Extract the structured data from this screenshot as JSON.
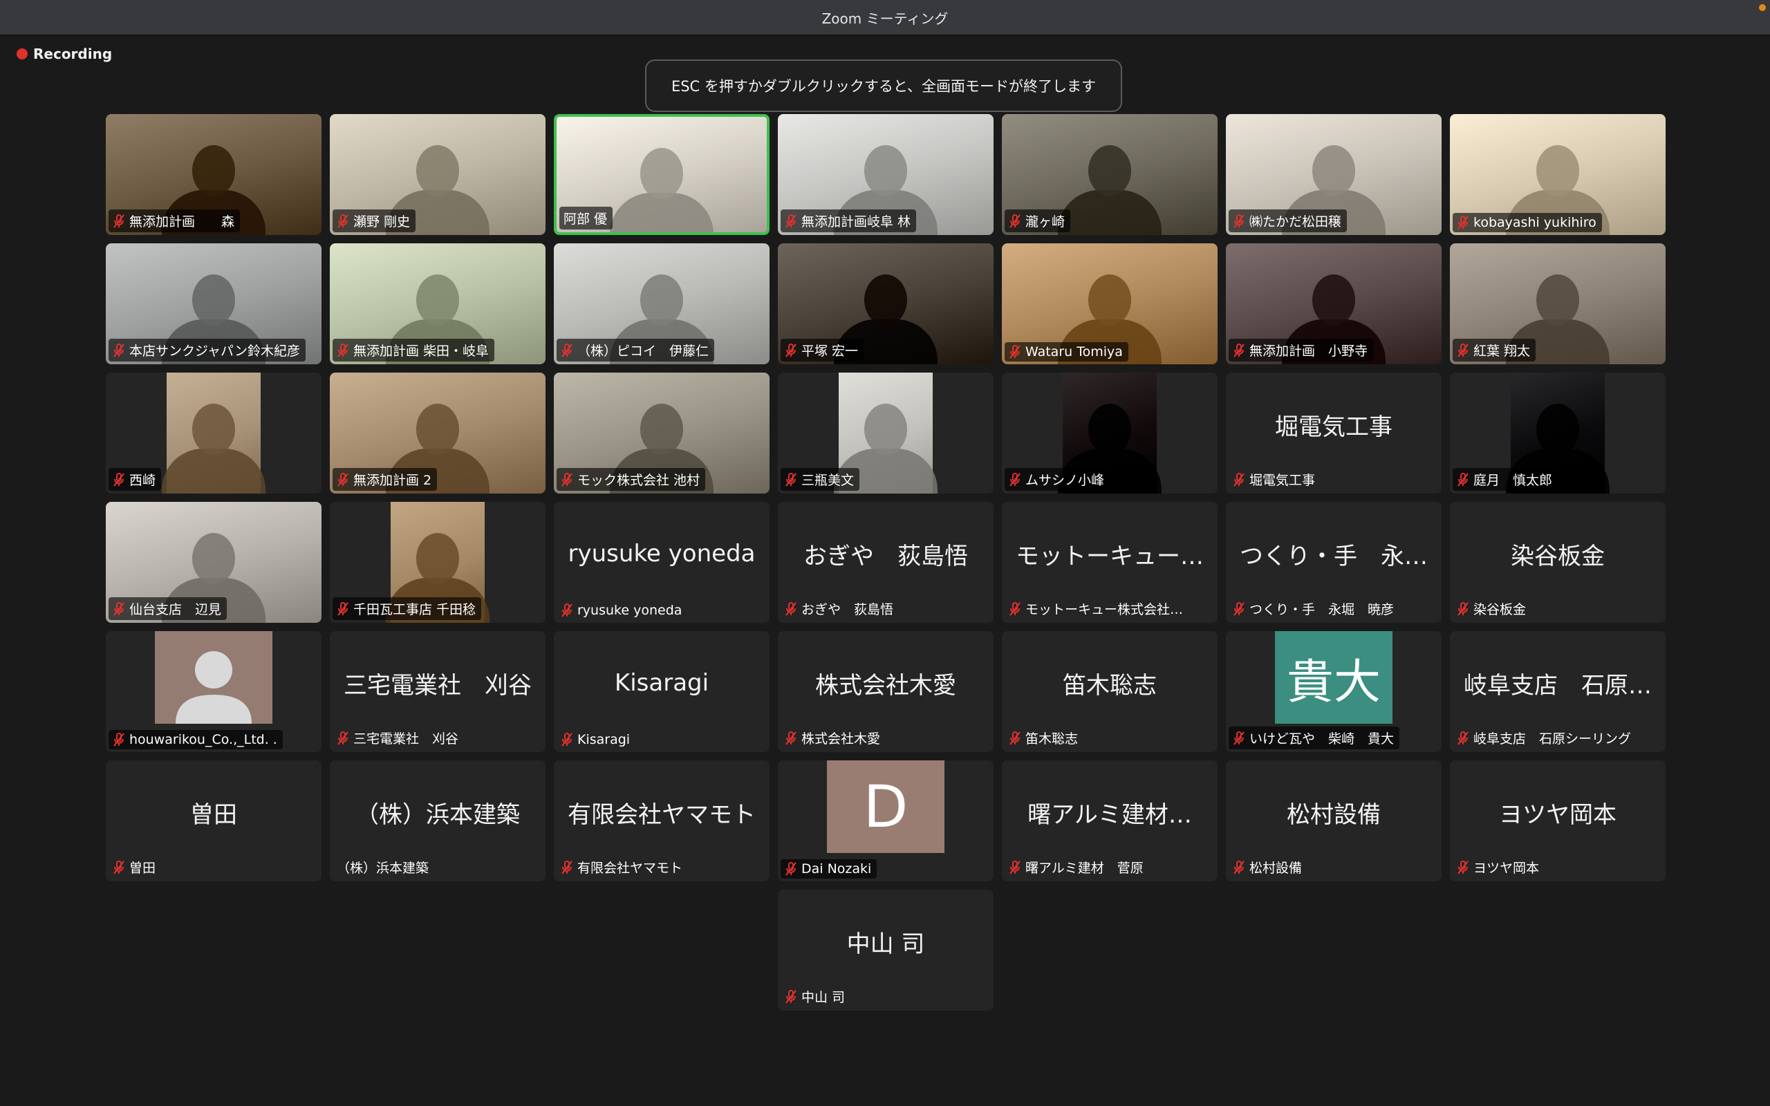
{
  "window": {
    "title": "Zoom ミーティング"
  },
  "recording": {
    "label": "Recording"
  },
  "banner": {
    "text": "ESC を押すかダブルクリックすると、全画面モードが終了します"
  },
  "participants": [
    {
      "name": "無添加計画　　森",
      "video": true,
      "bg": "#6d5a42",
      "muted": true
    },
    {
      "name": "瀬野 剛史",
      "video": true,
      "bg": "#bfb7a5",
      "muted": true
    },
    {
      "name": "阿部 優",
      "video": true,
      "bg": "#d6d1c7",
      "muted": false,
      "active": true
    },
    {
      "name": "無添加計画岐阜 林",
      "video": true,
      "bg": "#c5c5c2",
      "muted": true
    },
    {
      "name": "瀧ヶ崎",
      "video": true,
      "bg": "#6f6a5e",
      "muted": true
    },
    {
      "name": "㈱たかだ松田穣",
      "video": true,
      "bg": "#c9c3b8",
      "muted": true
    },
    {
      "name": "kobayashi yukihiro",
      "video": true,
      "bg": "#d8cbb2",
      "muted": true
    },
    {
      "name": "本店サンクジャパン鈴木紀彦",
      "video": true,
      "bg": "#9fa0a0",
      "muted": true
    },
    {
      "name": "無添加計画 柴田・岐阜",
      "video": true,
      "bg": "#b9c2a6",
      "muted": true
    },
    {
      "name": "（株）ピコイ　伊藤仁",
      "video": true,
      "bg": "#b9b9b5",
      "muted": true
    },
    {
      "name": "平塚 宏一",
      "video": true,
      "bg": "#4a4138",
      "muted": true
    },
    {
      "name": "Wataru Tomiya",
      "video": true,
      "bg": "#b08a5c",
      "muted": true
    },
    {
      "name": "無添加計画　小野寺",
      "video": true,
      "bg": "#5a4a4a",
      "muted": true
    },
    {
      "name": "紅葉 翔太",
      "video": true,
      "bg": "#8f8478",
      "muted": true
    },
    {
      "name": "西崎",
      "video": true,
      "bg": "#a89277",
      "muted": true,
      "pillar": true
    },
    {
      "name": "無添加計画 2",
      "video": true,
      "bg": "#a58c6f",
      "muted": true
    },
    {
      "name": "モック株式会社 池村",
      "video": true,
      "bg": "#9a9487",
      "muted": true
    },
    {
      "name": "三瓶美文",
      "video": true,
      "bg": "#c2c1bb",
      "muted": true,
      "pillar": true
    },
    {
      "name": "ムサシノ小峰",
      "video": true,
      "bg": "#120a0a",
      "muted": true,
      "pillar": true
    },
    {
      "name": "堀電気工事",
      "center": "堀電気工事",
      "muted": true
    },
    {
      "name": "庭月　慎太郎",
      "video": true,
      "bg": "#0a0a0d",
      "muted": true,
      "pillar": true
    },
    {
      "name": "仙台支店　辺見",
      "video": true,
      "bg": "#b7b2ac",
      "muted": true
    },
    {
      "name": "千田瓦工事店 千田稔",
      "video": true,
      "bg": "#a58865",
      "muted": true,
      "pillar": true
    },
    {
      "name": "ryusuke yoneda",
      "center": "ryusuke yoneda",
      "muted": true
    },
    {
      "name": "おぎや　荻島悟",
      "center": "おぎや　荻島悟",
      "muted": true
    },
    {
      "name": "モットーキュー株式会社…",
      "center": "モットーキュー…",
      "muted": true
    },
    {
      "name": "つくり・手　永堀　暁彦",
      "center": "つくり・手　永…",
      "muted": true
    },
    {
      "name": "染谷板金",
      "center": "染谷板金",
      "muted": true
    },
    {
      "name": "houwarikou_Co.,_Ltd. .",
      "avatar": "person",
      "avatar_color": "#957c73",
      "muted": true
    },
    {
      "name": "三宅電業社　刈谷",
      "center": "三宅電業社　刈谷",
      "muted": true
    },
    {
      "name": "Kisaragi",
      "center": "Kisaragi",
      "muted": true
    },
    {
      "name": "株式会社木愛",
      "center": "株式会社木愛",
      "muted": true
    },
    {
      "name": "笛木聡志",
      "center": "笛木聡志",
      "muted": true
    },
    {
      "name": "いけど瓦や　柴崎　貴大",
      "avatar": "貴大",
      "avatar_color": "#3b8e80",
      "muted": true
    },
    {
      "name": "岐阜支店　石原シーリング",
      "center": "岐阜支店　石原…",
      "muted": true
    },
    {
      "name": "曽田",
      "center": "曽田",
      "muted": true
    },
    {
      "name": "（株）浜本建築",
      "center": "（株）浜本建築",
      "muted": false
    },
    {
      "name": "有限会社ヤマモト",
      "center": "有限会社ヤマモト",
      "muted": true
    },
    {
      "name": "Dai Nozaki",
      "avatar": "D",
      "avatar_color": "#9a7d72",
      "muted": true
    },
    {
      "name": "曙アルミ建材　菅原",
      "center": "曙アルミ建材…",
      "muted": true
    },
    {
      "name": "松村設備",
      "center": "松村設備",
      "muted": true
    },
    {
      "name": "ヨツヤ岡本",
      "center": "ヨツヤ岡本",
      "muted": true
    },
    {
      "name": "中山 司",
      "center": "中山 司",
      "muted": true
    }
  ]
}
